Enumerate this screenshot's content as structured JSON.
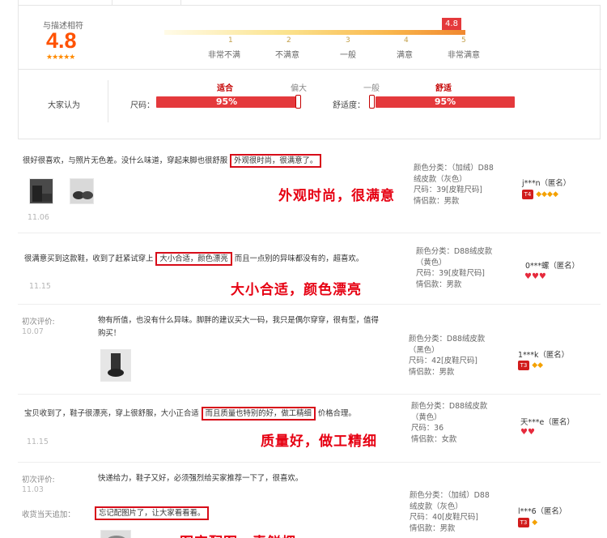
{
  "rating": {
    "match_label": "与描述相符",
    "score": "4.8",
    "stars": "★★★★★",
    "flag_score": "4.8",
    "scale": [
      {
        "num": "1",
        "label": "非常不满"
      },
      {
        "num": "2",
        "label": "不满意"
      },
      {
        "num": "3",
        "label": "一般"
      },
      {
        "num": "4",
        "label": "满意"
      },
      {
        "num": "5",
        "label": "非常满意"
      }
    ],
    "colors": {
      "accent": "#ff5200",
      "bar_red": "#e4393c",
      "caption_red": "#e60012"
    }
  },
  "consensus": {
    "label": "大家认为",
    "size": {
      "label": "尺码：",
      "word_fit": "适合",
      "word_big": "偏大",
      "percent": "95%",
      "fraction": 0.95
    },
    "comfort": {
      "label": "舒适度：",
      "word_avg": "一般",
      "word_comfy": "舒适",
      "percent": "95%",
      "fraction": 0.95
    }
  },
  "reviews": [
    {
      "text_before": "很好很喜欢，与照片无色差。没什么味道，穿起来脚也很舒服",
      "highlight": "外观很时尚，很满意了。",
      "text_after": "",
      "date": "11.06",
      "caption": "外观时尚，很满意",
      "attrs": [
        "颜色分类：（加绒）D88",
        "绒皮款（灰色）",
        "尺码：39[皮鞋尺码]",
        "情侣款：男款"
      ],
      "user": "j***n（匿名）",
      "level": "T4",
      "badge": "◆◆◆◆",
      "badge_type": "gem",
      "thumb_icons": [
        "shoe-photo-icon",
        "shoe-photo-icon"
      ]
    },
    {
      "text_before": "很满意买到这款鞋，收到了赶紧试穿上",
      "highlight": "大小合适，颜色漂亮",
      "text_after": "而且一点别的异味都没有的，超喜欢。",
      "date": "11.15",
      "caption": "大小合适，颜色漂亮",
      "attrs": [
        "颜色分类：D88绒皮款",
        "（黄色）",
        "尺码：39[皮鞋尺码]",
        "情侣款：男款"
      ],
      "user": "0***螺（匿名）",
      "level": "",
      "badge": "♥♥♥",
      "badge_type": "heart",
      "thumb_icons": []
    },
    {
      "first_label": "初次评价:",
      "date": "10.07",
      "text_before": "物有所值，也没有什么异味。脚胖的建议买大一码，我只是偶尔穿穿，很有型，值得购买！",
      "highlight": "",
      "text_after": "",
      "caption": "",
      "attrs": [
        "颜色分类：D88绒皮款",
        "（黑色）",
        "尺码：42[皮鞋尺码]",
        "情侣款：男款"
      ],
      "user": "1***k（匿名）",
      "level": "T3",
      "badge": "◆◆",
      "badge_type": "gem",
      "thumb_icons": [
        "shoe-photo-icon"
      ]
    },
    {
      "text_before": "宝贝收到了，鞋子很漂亮，穿上很舒服，大小正合适",
      "highlight": "而且质量也特别的好，做工精细",
      "text_after": "价格合理。",
      "date": "11.15",
      "caption": "质量好，做工精细",
      "attrs": [
        "颜色分类：D88绒皮款",
        "（黄色）",
        "尺码：36",
        "情侣款：女款"
      ],
      "user": "天***e（匿名）",
      "level": "",
      "badge": "♥♥",
      "badge_type": "heart",
      "thumb_icons": []
    },
    {
      "first_label": "初次评价:",
      "date": "11.03",
      "text_before": "快递给力，鞋子又好，必须强烈给买家推荐一下了，很喜欢。",
      "append_label": "收货当天追加：",
      "highlight": "忘记配图片了，让大家看看看。",
      "caption": "图定配图，素鲜烟",
      "attrs": [
        "颜色分类：（加绒）D88",
        "绒皮款（灰色）",
        "尺码：40[皮鞋尺码]",
        "情侣款：男款"
      ],
      "user": "l***6（匿名）",
      "level": "T3",
      "badge": "◆",
      "badge_type": "gem",
      "thumb_icons": [
        "shoe-photo-icon"
      ]
    }
  ]
}
